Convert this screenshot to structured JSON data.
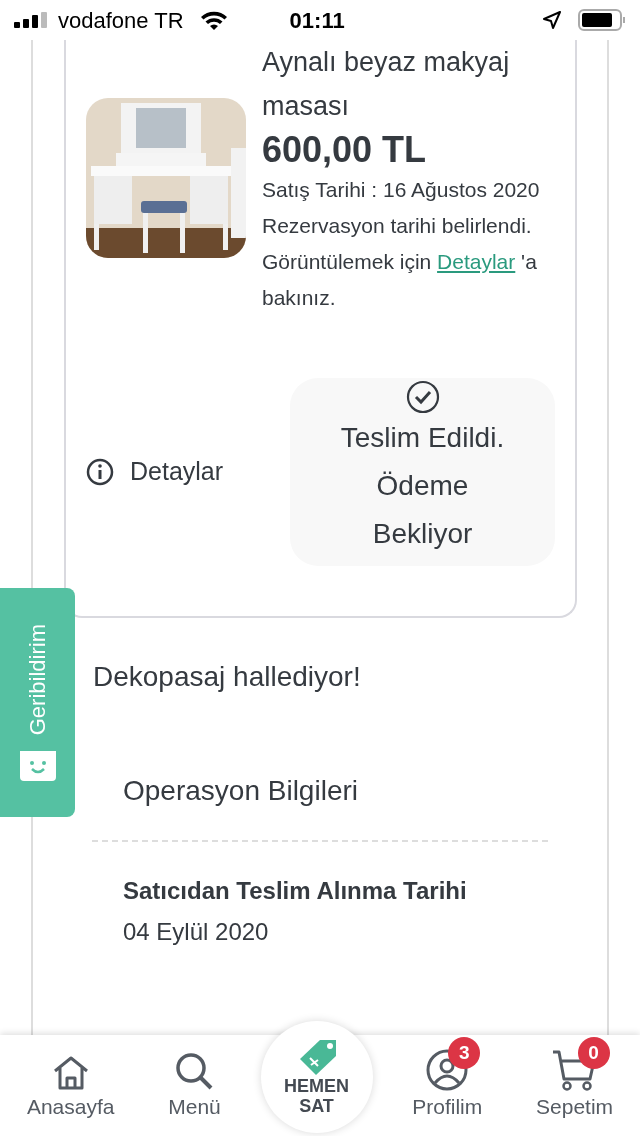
{
  "status_bar": {
    "carrier": "vodafone TR",
    "time": "01:11"
  },
  "order": {
    "title": "Aynalı beyaz makyaj masası",
    "price": "600,00 TL",
    "sale_date": "Satış Tarihi : 16 Ağustos 2020",
    "notice": "Rezervasyon tarihi belirlendi.",
    "view_text": "Görüntülemek için",
    "link": "Detaylar",
    "view_suffix": "'a bakınız.",
    "details_button": "Detaylar",
    "status_lines": [
      "Teslim Edildi.",
      "Ödeme",
      "Bekliyor"
    ]
  },
  "handler_text": "Dekopasaj hallediyor!",
  "operations": {
    "title": "Operasyon Bilgileri",
    "label": "Satıcıdan Teslim Alınma Tarihi",
    "value": "04 Eylül 2020"
  },
  "feedback_tab": "Geribildirim",
  "bottom_nav": [
    {
      "kind": "home",
      "label": "Anasayfa"
    },
    {
      "kind": "search",
      "label": "Menü"
    },
    {
      "kind": "sell",
      "label": "HEMEN SAT"
    },
    {
      "kind": "profile",
      "label": "Profilim",
      "badge": "3"
    },
    {
      "kind": "cart",
      "label": "Sepetim",
      "badge": "0"
    }
  ]
}
